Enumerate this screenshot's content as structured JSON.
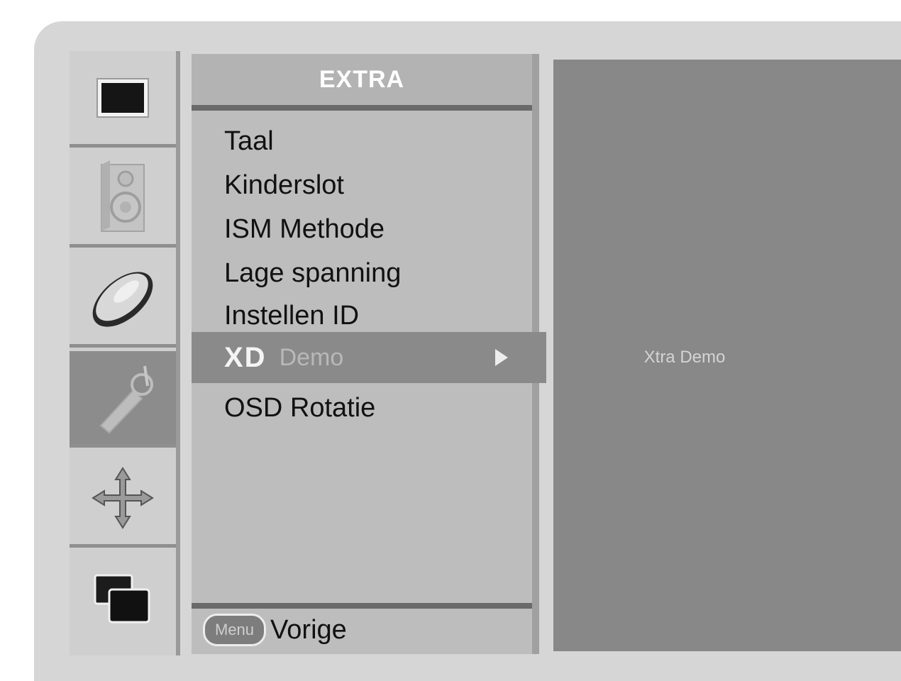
{
  "menu": {
    "title": "EXTRA",
    "items": [
      {
        "label": "Taal"
      },
      {
        "label": "Kinderslot"
      },
      {
        "label": "ISM Methode"
      },
      {
        "label": "Lage spanning"
      },
      {
        "label": "Instellen ID"
      },
      {
        "logo": "XD",
        "label": "Demo",
        "selected": true
      },
      {
        "label": "OSD Rotatie"
      }
    ]
  },
  "footer": {
    "key_label": "Menu",
    "back_label": "Vorige"
  },
  "submenu": {
    "item_label": "Xtra Demo"
  },
  "sidebar": {
    "icons": [
      "picture-icon",
      "speaker-icon",
      "disc-icon",
      "wrench-icon",
      "move-arrows-icon",
      "pip-windows-icon"
    ],
    "active_index": 3
  },
  "colors": {
    "frame": "#d6d6d6",
    "menu_bg": "#bdbdbd",
    "selected_bg": "#8a8a8a",
    "submenu_bg": "#888888"
  }
}
